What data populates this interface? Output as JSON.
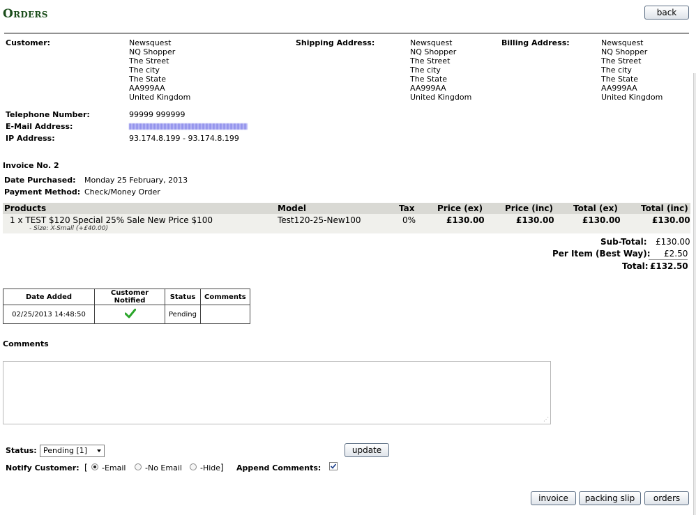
{
  "page": {
    "title": "Orders"
  },
  "buttons": {
    "back": "back",
    "update": "update",
    "invoice": "invoice",
    "packing_slip": "packing slip",
    "orders": "orders"
  },
  "customer": {
    "label": "Customer:",
    "lines": [
      "Newsquest",
      "NQ Shopper",
      "The Street",
      "The city",
      "The State",
      "AA999AA",
      "United Kingdom"
    ]
  },
  "shipping": {
    "label": "Shipping Address:",
    "lines": [
      "Newsquest",
      "NQ Shopper",
      "The Street",
      "The city",
      "The State",
      "AA999AA",
      "United Kingdom"
    ]
  },
  "billing": {
    "label": "Billing Address:",
    "lines": [
      "Newsquest",
      "NQ Shopper",
      "The Street",
      "The city",
      "The State",
      "AA999AA",
      "United Kingdom"
    ]
  },
  "contact": {
    "telephone_label": "Telephone Number:",
    "telephone": "99999 999999",
    "email_label": "E-Mail Address:",
    "ip_label": "IP Address:",
    "ip": "93.174.8.199 - 93.174.8.199"
  },
  "invoice": {
    "number": "Invoice No. 2",
    "date_label": "Date Purchased:",
    "date": "Monday 25 February, 2013",
    "payment_label": "Payment Method:",
    "payment": "Check/Money Order"
  },
  "products": {
    "headers": [
      "Products",
      "Model",
      "Tax",
      "Price (ex)",
      "Price (inc)",
      "Total (ex)",
      "Total (inc)"
    ],
    "rows": [
      {
        "product": "1 x TEST $120 Special 25% Sale New Price $100",
        "attribute": "- Size: X-Small (+£40.00)",
        "model": "Test120-25-New100",
        "tax": "0%",
        "price_ex": "£130.00",
        "price_inc": "£130.00",
        "total_ex": "£130.00",
        "total_inc": "£130.00"
      }
    ]
  },
  "totals": {
    "subtotal_label": "Sub-Total:",
    "subtotal": "£130.00",
    "shipping_label": "Per Item (Best Way):",
    "shipping": "£2.50",
    "total_label": "Total:",
    "total": "£132.50"
  },
  "history": {
    "headers": [
      "Date Added",
      "Customer Notified",
      "Status",
      "Comments"
    ],
    "rows": [
      {
        "date": "02/25/2013 14:48:50",
        "notified": "check-icon",
        "status": "Pending",
        "comments": ""
      }
    ]
  },
  "comments": {
    "label": "Comments",
    "value": ""
  },
  "status": {
    "label": "Status:",
    "selected": "Pending [1]"
  },
  "notify": {
    "label": "Notify Customer:",
    "open_bracket": "[",
    "close_bracket": "]",
    "options": [
      "-Email",
      "-No Email",
      "-Hide"
    ],
    "selected": "-Email",
    "append_label": "Append Comments:",
    "append_checked": true
  },
  "colors": {
    "title": "#1a4d1a",
    "table_header": "#d9d9d4",
    "table_row": "#f0f0ec",
    "check": "#2aa52a"
  }
}
